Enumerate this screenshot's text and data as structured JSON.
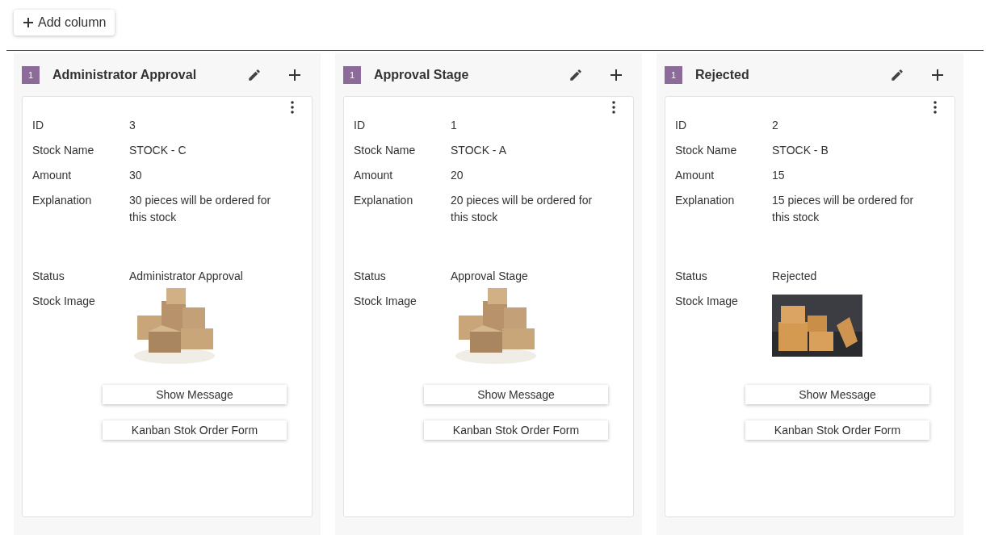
{
  "toolbar": {
    "add_button": "Add column"
  },
  "columns": [
    {
      "count": "1",
      "title": "Administrator Approval",
      "card": {
        "fields": [
          {
            "kind": "text",
            "label": "ID",
            "value": "3"
          },
          {
            "kind": "text",
            "label": "Stock Name",
            "value": "STOCK - C"
          },
          {
            "kind": "text",
            "label": "Amount",
            "value": "30"
          },
          {
            "kind": "long",
            "label": "Explanation",
            "value": "30 pieces will be ordered for this stock"
          },
          {
            "kind": "text",
            "label": "Status",
            "value": "Administrator Approval"
          },
          {
            "kind": "picture",
            "label": "Stock Image"
          }
        ],
        "buttons": [
          "Show Message",
          "Kanban Stok Order Form"
        ]
      }
    },
    {
      "count": "1",
      "title": "Approval Stage",
      "card": {
        "fields": [
          {
            "kind": "text",
            "label": "ID",
            "value": "1"
          },
          {
            "kind": "text",
            "label": "Stock Name",
            "value": "STOCK - A"
          },
          {
            "kind": "text",
            "label": "Amount",
            "value": "20"
          },
          {
            "kind": "long",
            "label": "Explanation",
            "value": "20 pieces will be ordered for this stock"
          },
          {
            "kind": "text",
            "label": "Status",
            "value": "Approval Stage"
          },
          {
            "kind": "picture",
            "label": "Stock Image"
          }
        ],
        "buttons": [
          "Show Message",
          "Kanban Stok Order Form"
        ]
      }
    },
    {
      "count": "1",
      "title": "Rejected",
      "card": {
        "fields": [
          {
            "kind": "text",
            "label": "ID",
            "value": "2"
          },
          {
            "kind": "text",
            "label": "Stock Name",
            "value": "STOCK - B"
          },
          {
            "kind": "text",
            "label": "Amount",
            "value": "15"
          },
          {
            "kind": "long",
            "label": "Explanation",
            "value": "15 pieces will be ordered for this stock"
          },
          {
            "kind": "text",
            "label": "Status",
            "value": "Rejected"
          },
          {
            "kind": "picture",
            "label": "Stock Image"
          }
        ],
        "buttons": [
          "Show Message",
          "Kanban Stok Order Form"
        ]
      }
    }
  ]
}
